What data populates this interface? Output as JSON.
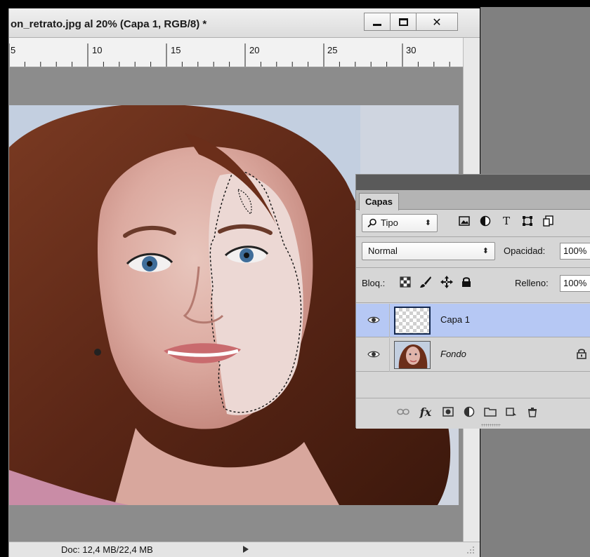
{
  "document": {
    "title": "on_retrato.jpg al 20% (Capa 1, RGB/8) *",
    "ruler_labels": [
      "5",
      "10",
      "15",
      "20",
      "25",
      "30"
    ],
    "status_doc": "Doc: 12,4 MB/22,4 MB"
  },
  "window_buttons": {
    "minimize": "minimize",
    "maximize": "maximize",
    "close": "✕"
  },
  "layers_panel": {
    "tab_label": "Capas",
    "filter_kind": "Tipo",
    "filter_icons": [
      "image-filter-icon",
      "adjustment-filter-icon",
      "type-filter-icon",
      "shape-filter-icon",
      "smart-object-filter-icon"
    ],
    "type_filter_glyph": "T",
    "blend_mode": "Normal",
    "opacity_label": "Opacidad:",
    "opacity_value": "100%",
    "lock_label": "Bloq.:",
    "fill_label": "Relleno:",
    "fill_value": "100%",
    "layers": [
      {
        "name": "Capa 1",
        "selected": true,
        "visible": true,
        "locked": false
      },
      {
        "name": "Fondo",
        "selected": false,
        "visible": true,
        "locked": true
      }
    ],
    "footer_fx": "fx",
    "footer_icons": [
      "link-layers-icon",
      "layer-style-fx-icon",
      "add-mask-icon",
      "adjustment-layer-icon",
      "new-group-icon",
      "new-layer-icon",
      "delete-layer-icon"
    ]
  },
  "colors": {
    "selected_layer": "#b6c8f4",
    "app_background": "#808080",
    "panel_background": "#d6d6d6"
  }
}
